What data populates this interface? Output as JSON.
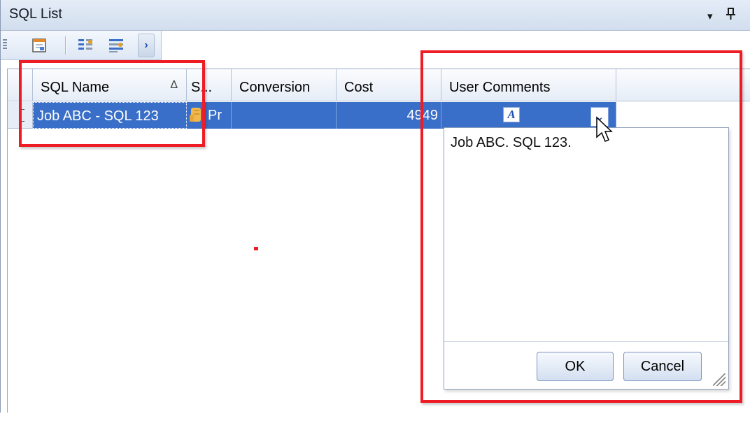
{
  "window": {
    "title": "SQL List",
    "dropdown_glyph": "▾",
    "pin_glyph": "ᵽ"
  },
  "toolbar": {
    "more_glyph": "›",
    "icons": [
      "grid-icon",
      "columns-icon",
      "rows-icon"
    ]
  },
  "grid": {
    "columns": [
      {
        "label": "SQL Name",
        "sort": "Δ"
      },
      {
        "label": "S..."
      },
      {
        "label": "Conversion"
      },
      {
        "label": "Cost"
      },
      {
        "label": "User Comments"
      }
    ],
    "rows": [
      {
        "sql_name": "Job ABC - SQL 123",
        "status": "Pr",
        "conversion": "",
        "cost": "4949",
        "comments_icon": "A"
      }
    ]
  },
  "popup": {
    "memo_text": "Job ABC. SQL 123.",
    "ok_label": "OK",
    "cancel_label": "Cancel",
    "dropdown_glyph": "⌄"
  },
  "colors": {
    "selection": "#3a6fc9",
    "highlight": "#ee1c24",
    "accent": "#1b4fb0"
  }
}
